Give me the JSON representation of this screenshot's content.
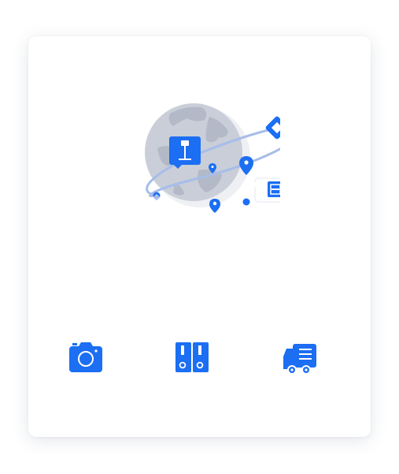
{
  "colors": {
    "accent": "#1c6ef3",
    "globe": "#c9ced8",
    "globe_land": "#b3b9c6",
    "globe_shadow": "#eef0f4",
    "orbit": "#a7bde9",
    "card_bg": "#ffffff"
  },
  "hero": {
    "icon": "globe-locations-illustration"
  },
  "actions": [
    {
      "icon": "camera-icon"
    },
    {
      "icon": "binders-icon"
    },
    {
      "icon": "delivery-truck-icon"
    }
  ]
}
